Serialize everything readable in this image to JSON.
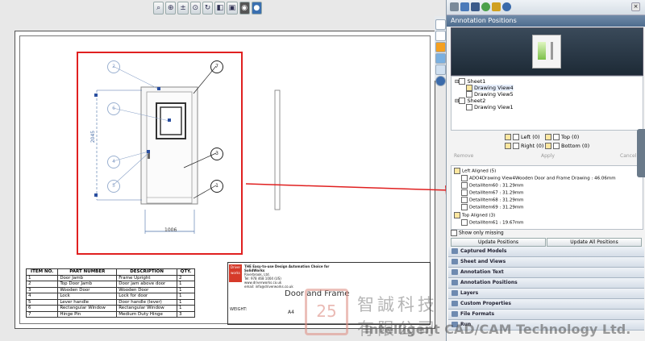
{
  "toolbar": {
    "icons": [
      "zoom-fit-icon",
      "zoom-area-icon",
      "zoom-in-out-icon",
      "zoom-selection-icon",
      "rotate-icon",
      "view-orientation-icon",
      "display-style-icon",
      "hide-show-icon",
      "appearance-icon"
    ]
  },
  "drawing": {
    "balloons": [
      "2",
      "6",
      "4",
      "5",
      "7",
      "3",
      "1"
    ],
    "dim_vertical": "2045",
    "dim_horizontal": "1006"
  },
  "bom": {
    "headers": [
      "ITEM NO.",
      "PART NUMBER",
      "DESCRIPTION",
      "QTY."
    ],
    "rows": [
      [
        "1",
        "Door Jamb",
        "Frame Upright",
        "2"
      ],
      [
        "2",
        "Top Door Jamb",
        "Door jam above door",
        "1"
      ],
      [
        "3",
        "Wooden Door",
        "Wooden Door",
        "1"
      ],
      [
        "4",
        "Lock",
        "Lock for door",
        "1"
      ],
      [
        "5",
        "Lever handle",
        "Door handle (lever)",
        "1"
      ],
      [
        "6",
        "Rectangular Window",
        "Rectangular Window",
        "1"
      ],
      [
        "7",
        "Hinge Pin",
        "Medium Duty Hinge",
        "3"
      ]
    ]
  },
  "title_block": {
    "logo_text": "Driver works",
    "heading": "THE Easy-to-use Design Automation Choice for SolidWorks",
    "lines": [
      "Riverbrook, Ltd.",
      "Tel: 978 468 1004 (US)",
      "www.driverworks.co.uk",
      "email: info@driverworks.co.uk"
    ],
    "title": "Door and Frame",
    "weight_label": "WEIGHT:",
    "size": "A4"
  },
  "panel": {
    "title": "Annotation Positions",
    "tree": [
      {
        "label": "Sheet1",
        "level": 0
      },
      {
        "label": "Drawing View4",
        "level": 1
      },
      {
        "label": "Drawing View5",
        "level": 1
      },
      {
        "label": "Sheet2",
        "level": 0
      },
      {
        "label": "Drawing View1",
        "level": 1
      }
    ],
    "positions": {
      "left": "Left (0)",
      "top": "Top (0)",
      "right": "Right (0)",
      "bottom": "Bottom (0)"
    },
    "buttons": {
      "remove": "Remove",
      "apply": "Apply",
      "cancel": "Cancel"
    },
    "list": [
      "Left Aligned (5)",
      "ADO4Drawing View4Wooden Door and Frame Drawing : 46.06mm",
      "DetailItem60 : 31.29mm",
      "DetailItem67 : 31.29mm",
      "DetailItem68 : 31.29mm",
      "DetailItem69 : 31.29mm",
      "Top Aligned (3)",
      "DetailItem61 : 19.67mm"
    ],
    "show_missing": "Show only missing",
    "update_positions": "Update Positions",
    "update_all": "Update All Positions",
    "sections": [
      "Captured Models",
      "Sheet and Views",
      "Annotation Text",
      "Annotation Positions",
      "Layers",
      "Custom Properties",
      "File Formats",
      "Run"
    ]
  },
  "watermark": {
    "logo": "25",
    "chinese": "智誠科技有限公司",
    "english": "Intelligent CAD/CAM Technology Ltd."
  }
}
